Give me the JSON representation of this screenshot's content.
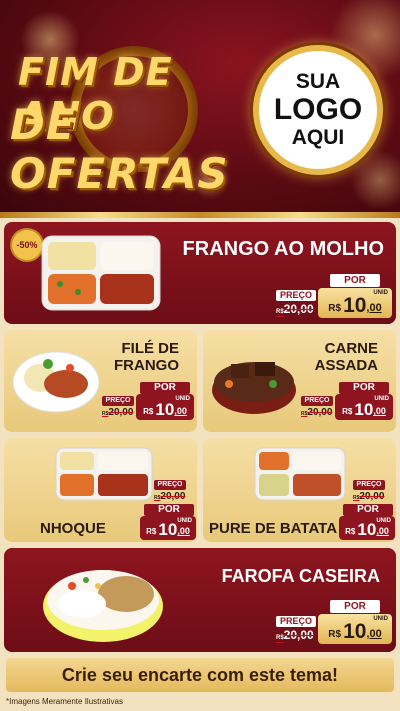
{
  "hero": {
    "line1": "FIM DE ANO",
    "line2": "DE OFERTAS"
  },
  "logo": {
    "line1": "SUA",
    "line2": "LOGO",
    "line3": "AQUI"
  },
  "products": [
    {
      "name": "FRANGO AO MOLHO",
      "discount_badge": "-50%",
      "preco_label": "PREÇO",
      "old_price": "20,00",
      "old_prefix": "R$",
      "por_label": "POR",
      "currency": "R$",
      "price_int": "10",
      "price_dec": ",00",
      "unit": "UNID"
    },
    {
      "name_line1": "FILÉ DE",
      "name_line2": "FRANGO",
      "preco_label": "PREÇO",
      "old_price": "20,00",
      "old_prefix": "R$",
      "por_label": "POR",
      "currency": "R$",
      "price_int": "10",
      "price_dec": ",00",
      "unit": "UNID"
    },
    {
      "name_line1": "CARNE",
      "name_line2": "ASSADA",
      "preco_label": "PREÇO",
      "old_price": "20,00",
      "old_prefix": "R$",
      "por_label": "POR",
      "currency": "R$",
      "price_int": "10",
      "price_dec": ",00",
      "unit": "UNID"
    },
    {
      "name": "NHOQUE",
      "preco_label": "PREÇO",
      "old_price": "20,00",
      "old_prefix": "R$",
      "por_label": "POR",
      "currency": "R$",
      "price_int": "10",
      "price_dec": ",00",
      "unit": "UNID"
    },
    {
      "name": "PURE DE BATATA",
      "preco_label": "PREÇO",
      "old_price": "20,00",
      "old_prefix": "R$",
      "por_label": "POR",
      "currency": "R$",
      "price_int": "10",
      "price_dec": ",00",
      "unit": "UNID"
    },
    {
      "name": "FAROFA CASEIRA",
      "preco_label": "PREÇO",
      "old_price": "20,00",
      "old_prefix": "R$",
      "por_label": "POR",
      "currency": "R$",
      "price_int": "10",
      "price_dec": ",00",
      "unit": "UNID"
    }
  ],
  "footer": {
    "banner": "Crie seu encarte com este tema!",
    "disclaimer": "*Imagens Meramente Ilustrativas"
  },
  "colors": {
    "primary_red": "#8e1520",
    "gold": "#f2c24a",
    "cream": "#f3e2bf"
  }
}
